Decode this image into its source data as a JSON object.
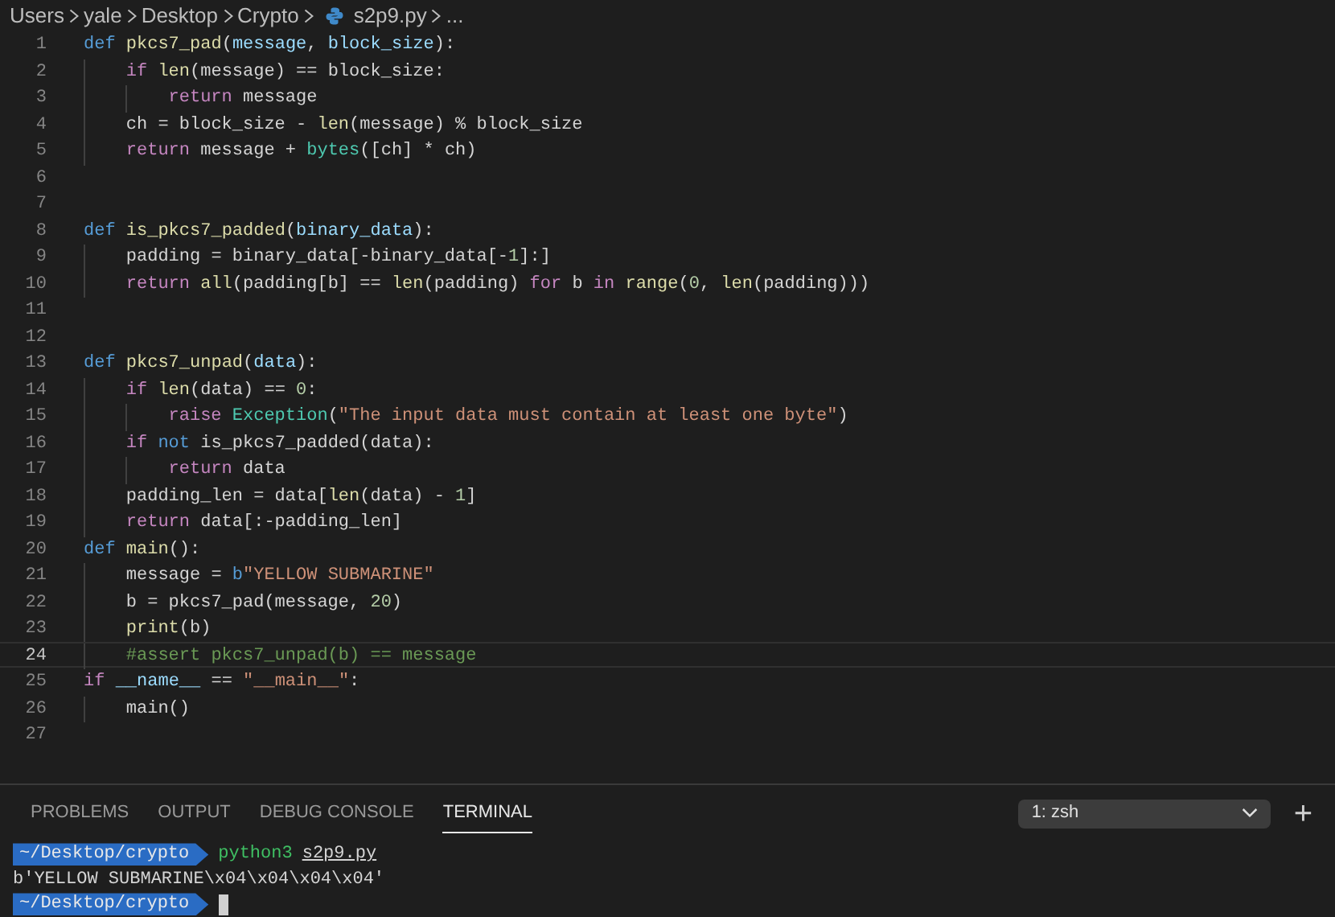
{
  "breadcrumb": [
    {
      "kind": "folder",
      "text": "Users"
    },
    {
      "kind": "folder",
      "text": "yale"
    },
    {
      "kind": "folder",
      "text": "Desktop"
    },
    {
      "kind": "folder",
      "text": "Crypto"
    },
    {
      "kind": "file",
      "text": "s2p9.py"
    },
    {
      "kind": "more",
      "text": "..."
    }
  ],
  "editor": {
    "lines": [
      {
        "number": "1",
        "current": false,
        "tokens": [
          {
            "kind": "kw",
            "text": "def "
          },
          {
            "kind": "fn",
            "text": "pkcs7_pad"
          },
          {
            "kind": "op",
            "text": "("
          },
          {
            "kind": "param",
            "text": "message"
          },
          {
            "kind": "op",
            "text": ", "
          },
          {
            "kind": "param",
            "text": "block_size"
          },
          {
            "kind": "op",
            "text": "):"
          }
        ]
      },
      {
        "number": "2",
        "current": false,
        "tokens": [
          {
            "kind": "ctrl",
            "text": "    if "
          },
          {
            "kind": "fn",
            "text": "len"
          },
          {
            "kind": "op",
            "text": "(message) == block_size:"
          }
        ]
      },
      {
        "number": "3",
        "current": false,
        "tokens": [
          {
            "kind": "ctrl",
            "text": "        return"
          },
          {
            "kind": "op",
            "text": " message"
          }
        ]
      },
      {
        "number": "4",
        "current": false,
        "tokens": [
          {
            "kind": "op",
            "text": "    ch = block_size - "
          },
          {
            "kind": "fn",
            "text": "len"
          },
          {
            "kind": "op",
            "text": "(message) % block_size"
          }
        ]
      },
      {
        "number": "5",
        "current": false,
        "tokens": [
          {
            "kind": "ctrl",
            "text": "    return"
          },
          {
            "kind": "op",
            "text": " message + "
          },
          {
            "kind": "cls",
            "text": "bytes"
          },
          {
            "kind": "op",
            "text": "([ch] * ch)"
          }
        ]
      },
      {
        "number": "6",
        "current": false
      },
      {
        "number": "7",
        "current": false
      },
      {
        "number": "8",
        "current": false,
        "tokens": [
          {
            "kind": "kw",
            "text": "def "
          },
          {
            "kind": "fn",
            "text": "is_pkcs7_padded"
          },
          {
            "kind": "op",
            "text": "("
          },
          {
            "kind": "param",
            "text": "binary_data"
          },
          {
            "kind": "op",
            "text": "):"
          }
        ]
      },
      {
        "number": "9",
        "current": false,
        "tokens": [
          {
            "kind": "op",
            "text": "    padding = binary_data[-binary_data[-"
          },
          {
            "kind": "num",
            "text": "1"
          },
          {
            "kind": "op",
            "text": "]:]"
          }
        ]
      },
      {
        "number": "10",
        "current": false,
        "tokens": [
          {
            "kind": "ctrl",
            "text": "    return "
          },
          {
            "kind": "fn",
            "text": "all"
          },
          {
            "kind": "op",
            "text": "(padding[b] == "
          },
          {
            "kind": "fn",
            "text": "len"
          },
          {
            "kind": "op",
            "text": "(padding) "
          },
          {
            "kind": "ctrl",
            "text": "for"
          },
          {
            "kind": "op",
            "text": " b "
          },
          {
            "kind": "ctrl",
            "text": "in "
          },
          {
            "kind": "fn",
            "text": "range"
          },
          {
            "kind": "op",
            "text": "("
          },
          {
            "kind": "num",
            "text": "0"
          },
          {
            "kind": "op",
            "text": ", "
          },
          {
            "kind": "fn",
            "text": "len"
          },
          {
            "kind": "op",
            "text": "(padding)))"
          }
        ]
      },
      {
        "number": "11",
        "current": false
      },
      {
        "number": "12",
        "current": false
      },
      {
        "number": "13",
        "current": false,
        "tokens": [
          {
            "kind": "kw",
            "text": "def "
          },
          {
            "kind": "fn",
            "text": "pkcs7_unpad"
          },
          {
            "kind": "op",
            "text": "("
          },
          {
            "kind": "param",
            "text": "data"
          },
          {
            "kind": "op",
            "text": "):"
          }
        ]
      },
      {
        "number": "14",
        "current": false,
        "tokens": [
          {
            "kind": "ctrl",
            "text": "    if "
          },
          {
            "kind": "fn",
            "text": "len"
          },
          {
            "kind": "op",
            "text": "(data) == "
          },
          {
            "kind": "num",
            "text": "0"
          },
          {
            "kind": "op",
            "text": ":"
          }
        ]
      },
      {
        "number": "15",
        "current": false,
        "tokens": [
          {
            "kind": "ctrl",
            "text": "        raise "
          },
          {
            "kind": "cls",
            "text": "Exception"
          },
          {
            "kind": "op",
            "text": "("
          },
          {
            "kind": "str",
            "text": "\"The input data must contain at least one byte\""
          },
          {
            "kind": "op",
            "text": ")"
          }
        ]
      },
      {
        "number": "16",
        "current": false,
        "tokens": [
          {
            "kind": "ctrl",
            "text": "    if "
          },
          {
            "kind": "kw",
            "text": "not"
          },
          {
            "kind": "op",
            "text": " is_pkcs7_padded(data):"
          }
        ]
      },
      {
        "number": "17",
        "current": false,
        "tokens": [
          {
            "kind": "ctrl",
            "text": "        return"
          },
          {
            "kind": "op",
            "text": " data"
          }
        ]
      },
      {
        "number": "18",
        "current": false,
        "tokens": [
          {
            "kind": "op",
            "text": "    padding_len = data["
          },
          {
            "kind": "fn",
            "text": "len"
          },
          {
            "kind": "op",
            "text": "(data) - "
          },
          {
            "kind": "num",
            "text": "1"
          },
          {
            "kind": "op",
            "text": "]"
          }
        ]
      },
      {
        "number": "19",
        "current": false,
        "tokens": [
          {
            "kind": "ctrl",
            "text": "    return"
          },
          {
            "kind": "op",
            "text": " data[:-padding_len]"
          }
        ]
      },
      {
        "number": "20",
        "current": false,
        "tokens": [
          {
            "kind": "kw",
            "text": "def "
          },
          {
            "kind": "fn",
            "text": "main"
          },
          {
            "kind": "op",
            "text": "():"
          }
        ]
      },
      {
        "number": "21",
        "current": false,
        "tokens": [
          {
            "kind": "op",
            "text": "    message = "
          },
          {
            "kind": "kw",
            "text": "b"
          },
          {
            "kind": "str",
            "text": "\"YELLOW SUBMARINE\""
          }
        ]
      },
      {
        "number": "22",
        "current": false,
        "tokens": [
          {
            "kind": "op",
            "text": "    b = pkcs7_pad(message, "
          },
          {
            "kind": "num",
            "text": "20"
          },
          {
            "kind": "op",
            "text": ")"
          }
        ]
      },
      {
        "number": "23",
        "current": false,
        "tokens": [
          {
            "kind": "fn",
            "text": "    print"
          },
          {
            "kind": "op",
            "text": "(b)"
          }
        ]
      },
      {
        "number": "24",
        "current": true,
        "tokens": [
          {
            "kind": "com",
            "text": "    #assert pkcs7_unpad(b) == message"
          }
        ]
      },
      {
        "number": "25",
        "current": false,
        "tokens": [
          {
            "kind": "ctrl",
            "text": "if "
          },
          {
            "kind": "param",
            "text": "__name__"
          },
          {
            "kind": "op",
            "text": " == "
          },
          {
            "kind": "str",
            "text": "\"__main__\""
          },
          {
            "kind": "op",
            "text": ":"
          }
        ]
      },
      {
        "number": "26",
        "current": false,
        "tokens": [
          {
            "kind": "op",
            "text": "    main()"
          }
        ]
      },
      {
        "number": "27",
        "current": false
      }
    ]
  },
  "panel": {
    "tabs": [
      {
        "label": "PROBLEMS",
        "selected": false
      },
      {
        "label": "OUTPUT",
        "selected": false
      },
      {
        "label": "DEBUG CONSOLE",
        "selected": false
      },
      {
        "label": "TERMINAL",
        "selected": true
      }
    ],
    "terminal_selector": "1: zsh",
    "add_button": "+"
  },
  "terminal": {
    "lines": [
      {
        "kind": "command",
        "prompt": "~/Desktop/crypto",
        "command": "python3",
        "argument": "s2p9.py"
      },
      {
        "kind": "output",
        "text": "b'YELLOW SUBMARINE\\x04\\x04\\x04\\x04'"
      },
      {
        "kind": "input",
        "prompt": "~/Desktop/crypto"
      }
    ]
  }
}
